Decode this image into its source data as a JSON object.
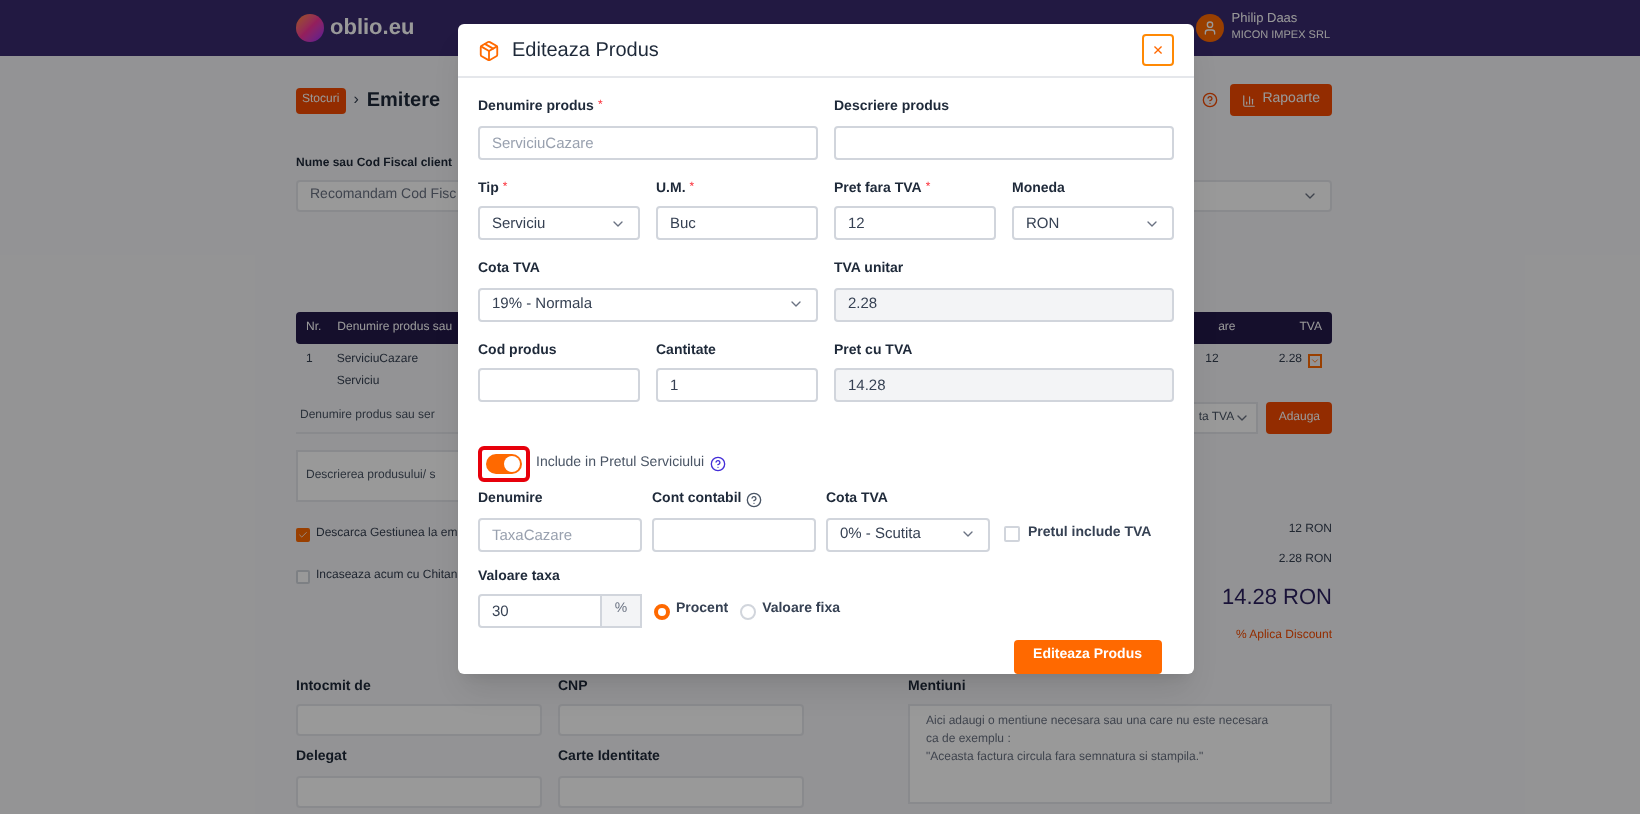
{
  "navbar": {
    "logo": "oblio.eu",
    "user_name": "Philip Daas",
    "company": "MICON IMPEX SRL"
  },
  "page": {
    "breadcrumb": "Stocuri",
    "separator": "›",
    "title": "Emitere",
    "reports_button": "Rapoarte",
    "client_label": "Nume sau Cod Fiscal client",
    "client_placeholder": "Recomandam Cod Fisc",
    "table": {
      "columns": [
        "Nr.",
        "Denumire produs sau",
        "are",
        "TVA"
      ],
      "rows": [
        {
          "nr": "1",
          "name": "ServiciuCazare",
          "type": "Serviciu",
          "price": "12",
          "vat": "2.28"
        }
      ]
    },
    "product_placeholder": "Denumire produs sau ser",
    "vat_select": "ta TVA",
    "add_button": "Adauga",
    "description_placeholder": "Descrierea produsului/ s",
    "options": [
      {
        "label": "Descarca Gestiunea la em",
        "checked": true
      },
      {
        "label": "Incaseaza acum cu Chitan",
        "checked": false
      }
    ],
    "totals": {
      "subtotal": "12 RON",
      "vat": "2.28 RON",
      "total": "14.28 RON",
      "discount_link": "% Aplica Discount"
    },
    "bottom_fields": [
      {
        "label": "Intocmit de"
      },
      {
        "label": "CNP"
      },
      {
        "label": "Delegat"
      },
      {
        "label": "Carte Identitate"
      }
    ],
    "mentions": {
      "label": "Mentiuni",
      "placeholder": "Aici adaugi o mentiune necesara sau una care nu este necesara\nca de exemplu :\n\"Aceasta factura circula fara semnatura si stampila.\""
    }
  },
  "modal": {
    "title": "Editeaza Produs",
    "close": "×",
    "required_mark": "*",
    "field_rows": [
      [
        {
          "label": "Denumire produs",
          "required": true,
          "kind": "input",
          "placeholder": "ServiciuCazare"
        },
        {
          "label": "Descriere produs",
          "required": false,
          "kind": "textarea"
        }
      ],
      [
        {
          "label": "Tip",
          "required": true,
          "kind": "select",
          "value": "Serviciu"
        },
        {
          "label": "U.M.",
          "required": true,
          "kind": "input",
          "value": "Buc"
        },
        {
          "label": "Pret fara TVA",
          "required": true,
          "kind": "input",
          "value": "12"
        },
        {
          "label": "Moneda",
          "required": false,
          "kind": "select",
          "value": "RON"
        }
      ],
      [
        {
          "label": "Cota TVA",
          "required": false,
          "kind": "select",
          "value": "19% - Normala"
        },
        {
          "label": "TVA unitar",
          "required": false,
          "kind": "readonly",
          "value": "2.28"
        }
      ],
      [
        {
          "label": "Cod produs",
          "required": false,
          "kind": "input"
        },
        {
          "label": "Cantitate",
          "required": false,
          "kind": "input",
          "value": "1"
        },
        {
          "label": "Pret cu TVA",
          "required": false,
          "kind": "readonly",
          "value": "14.28"
        }
      ]
    ],
    "tax": {
      "enabled": true,
      "label": "Include in Pretul Serviciului",
      "help": true,
      "fields": [
        {
          "label": "Denumire",
          "help": false,
          "kind": "input",
          "placeholder": "TaxaCazare"
        },
        {
          "label": "Cont contabil",
          "help": true,
          "kind": "input"
        },
        {
          "label": "Cota TVA",
          "help": false,
          "kind": "select",
          "value": "0% - Scutita"
        }
      ],
      "includes_vat": {
        "label": "Pretul include TVA",
        "checked": false
      },
      "amount": {
        "label": "Valoare taxa",
        "value": "30",
        "unit": "%"
      },
      "modes": [
        {
          "label": "Procent",
          "selected": true
        },
        {
          "label": "Valoare fixa",
          "selected": false
        }
      ]
    },
    "submit": "Editeaza Produs"
  }
}
